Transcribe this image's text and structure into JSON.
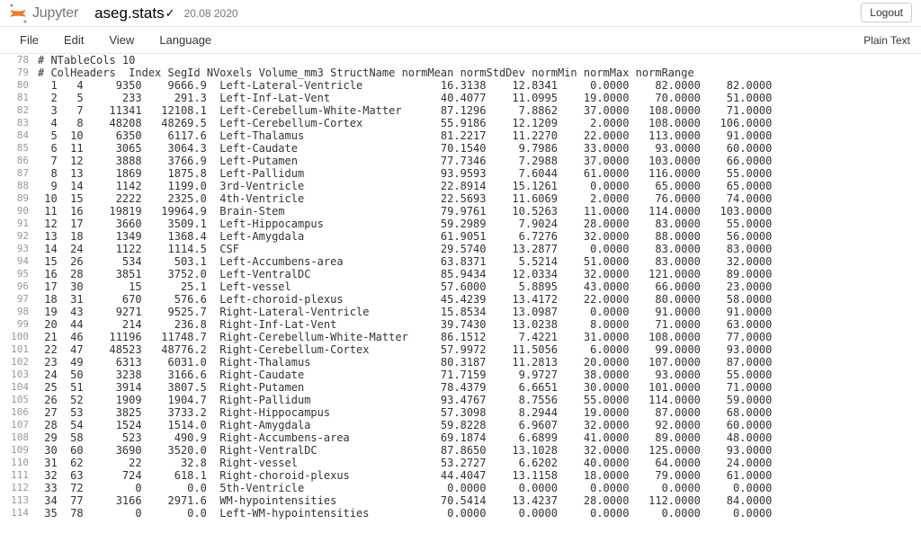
{
  "header": {
    "logo_text": "Jupyter",
    "filename": "aseg.stats",
    "check_glyph": "✓",
    "file_date": "20.08 2020",
    "logout_label": "Logout"
  },
  "menu": {
    "items": [
      "File",
      "Edit",
      "View",
      "Language"
    ],
    "mode": "Plain Text"
  },
  "stats": {
    "header_lines": [
      {
        "n": 78,
        "text": "# NTableCols 10"
      },
      {
        "n": 79,
        "text": "# ColHeaders  Index SegId NVoxels Volume_mm3 StructName normMean normStdDev normMin normMax normRange"
      }
    ],
    "cols": [
      "Index",
      "SegId",
      "NVoxels",
      "Volume_mm3",
      "StructName",
      "normMean",
      "normStdDev",
      "normMin",
      "normMax",
      "normRange"
    ],
    "rows": [
      {
        "n": 80,
        "Index": " 1",
        "SegId": "  4",
        "NVoxels": "    9350",
        "Volume_mm3": "   9666.9",
        "StructName": "Left-Lateral-Ventricle",
        "normMean": "16.3138",
        "normStdDev": "12.8341",
        "normMin": " 0.0000",
        "normMax": " 82.0000",
        "normRange": " 82.0000"
      },
      {
        "n": 81,
        "Index": " 2",
        "SegId": "  5",
        "NVoxels": "     233",
        "Volume_mm3": "    291.3",
        "StructName": "Left-Inf-Lat-Vent",
        "normMean": "40.4077",
        "normStdDev": "11.0995",
        "normMin": "19.0000",
        "normMax": " 70.0000",
        "normRange": " 51.0000"
      },
      {
        "n": 82,
        "Index": " 3",
        "SegId": "  7",
        "NVoxels": "   11341",
        "Volume_mm3": "  12108.1",
        "StructName": "Left-Cerebellum-White-Matter",
        "normMean": "87.1296",
        "normStdDev": " 7.8862",
        "normMin": "37.0000",
        "normMax": "108.0000",
        "normRange": " 71.0000"
      },
      {
        "n": 83,
        "Index": " 4",
        "SegId": "  8",
        "NVoxels": "   48208",
        "Volume_mm3": "  48269.5",
        "StructName": "Left-Cerebellum-Cortex",
        "normMean": "55.9186",
        "normStdDev": "12.1209",
        "normMin": " 2.0000",
        "normMax": "108.0000",
        "normRange": "106.0000"
      },
      {
        "n": 84,
        "Index": " 5",
        "SegId": " 10",
        "NVoxels": "    6350",
        "Volume_mm3": "   6117.6",
        "StructName": "Left-Thalamus",
        "normMean": "81.2217",
        "normStdDev": "11.2270",
        "normMin": "22.0000",
        "normMax": "113.0000",
        "normRange": " 91.0000"
      },
      {
        "n": 85,
        "Index": " 6",
        "SegId": " 11",
        "NVoxels": "    3065",
        "Volume_mm3": "   3064.3",
        "StructName": "Left-Caudate",
        "normMean": "70.1540",
        "normStdDev": " 9.7986",
        "normMin": "33.0000",
        "normMax": " 93.0000",
        "normRange": " 60.0000"
      },
      {
        "n": 86,
        "Index": " 7",
        "SegId": " 12",
        "NVoxels": "    3888",
        "Volume_mm3": "   3766.9",
        "StructName": "Left-Putamen",
        "normMean": "77.7346",
        "normStdDev": " 7.2988",
        "normMin": "37.0000",
        "normMax": "103.0000",
        "normRange": " 66.0000"
      },
      {
        "n": 87,
        "Index": " 8",
        "SegId": " 13",
        "NVoxels": "    1869",
        "Volume_mm3": "   1875.8",
        "StructName": "Left-Pallidum",
        "normMean": "93.9593",
        "normStdDev": " 7.6044",
        "normMin": "61.0000",
        "normMax": "116.0000",
        "normRange": " 55.0000"
      },
      {
        "n": 88,
        "Index": " 9",
        "SegId": " 14",
        "NVoxels": "    1142",
        "Volume_mm3": "   1199.0",
        "StructName": "3rd-Ventricle",
        "normMean": "22.8914",
        "normStdDev": "15.1261",
        "normMin": " 0.0000",
        "normMax": " 65.0000",
        "normRange": " 65.0000"
      },
      {
        "n": 89,
        "Index": "10",
        "SegId": " 15",
        "NVoxels": "    2222",
        "Volume_mm3": "   2325.0",
        "StructName": "4th-Ventricle",
        "normMean": "22.5693",
        "normStdDev": "11.6069",
        "normMin": " 2.0000",
        "normMax": " 76.0000",
        "normRange": " 74.0000"
      },
      {
        "n": 90,
        "Index": "11",
        "SegId": " 16",
        "NVoxels": "   19819",
        "Volume_mm3": "  19964.9",
        "StructName": "Brain-Stem",
        "normMean": "79.9761",
        "normStdDev": "10.5263",
        "normMin": "11.0000",
        "normMax": "114.0000",
        "normRange": "103.0000"
      },
      {
        "n": 91,
        "Index": "12",
        "SegId": " 17",
        "NVoxels": "    3660",
        "Volume_mm3": "   3509.1",
        "StructName": "Left-Hippocampus",
        "normMean": "59.2989",
        "normStdDev": " 7.9024",
        "normMin": "28.0000",
        "normMax": " 83.0000",
        "normRange": " 55.0000"
      },
      {
        "n": 92,
        "Index": "13",
        "SegId": " 18",
        "NVoxels": "    1349",
        "Volume_mm3": "   1368.4",
        "StructName": "Left-Amygdala",
        "normMean": "61.9051",
        "normStdDev": " 6.7276",
        "normMin": "32.0000",
        "normMax": " 88.0000",
        "normRange": " 56.0000"
      },
      {
        "n": 93,
        "Index": "14",
        "SegId": " 24",
        "NVoxels": "    1122",
        "Volume_mm3": "   1114.5",
        "StructName": "CSF",
        "normMean": "29.5740",
        "normStdDev": "13.2877",
        "normMin": " 0.0000",
        "normMax": " 83.0000",
        "normRange": " 83.0000"
      },
      {
        "n": 94,
        "Index": "15",
        "SegId": " 26",
        "NVoxels": "     534",
        "Volume_mm3": "    503.1",
        "StructName": "Left-Accumbens-area",
        "normMean": "63.8371",
        "normStdDev": " 5.5214",
        "normMin": "51.0000",
        "normMax": " 83.0000",
        "normRange": " 32.0000"
      },
      {
        "n": 95,
        "Index": "16",
        "SegId": " 28",
        "NVoxels": "    3851",
        "Volume_mm3": "   3752.0",
        "StructName": "Left-VentralDC",
        "normMean": "85.9434",
        "normStdDev": "12.0334",
        "normMin": "32.0000",
        "normMax": "121.0000",
        "normRange": " 89.0000"
      },
      {
        "n": 96,
        "Index": "17",
        "SegId": " 30",
        "NVoxels": "      15",
        "Volume_mm3": "     25.1",
        "StructName": "Left-vessel",
        "normMean": "57.6000",
        "normStdDev": " 5.8895",
        "normMin": "43.0000",
        "normMax": " 66.0000",
        "normRange": " 23.0000"
      },
      {
        "n": 97,
        "Index": "18",
        "SegId": " 31",
        "NVoxels": "     670",
        "Volume_mm3": "    576.6",
        "StructName": "Left-choroid-plexus",
        "normMean": "45.4239",
        "normStdDev": "13.4172",
        "normMin": "22.0000",
        "normMax": " 80.0000",
        "normRange": " 58.0000"
      },
      {
        "n": 98,
        "Index": "19",
        "SegId": " 43",
        "NVoxels": "    9271",
        "Volume_mm3": "   9525.7",
        "StructName": "Right-Lateral-Ventricle",
        "normMean": "15.8534",
        "normStdDev": "13.0987",
        "normMin": " 0.0000",
        "normMax": " 91.0000",
        "normRange": " 91.0000"
      },
      {
        "n": 99,
        "Index": "20",
        "SegId": " 44",
        "NVoxels": "     214",
        "Volume_mm3": "    236.8",
        "StructName": "Right-Inf-Lat-Vent",
        "normMean": "39.7430",
        "normStdDev": "13.0238",
        "normMin": " 8.0000",
        "normMax": " 71.0000",
        "normRange": " 63.0000"
      },
      {
        "n": 100,
        "Index": "21",
        "SegId": " 46",
        "NVoxels": "   11196",
        "Volume_mm3": "  11748.7",
        "StructName": "Right-Cerebellum-White-Matter",
        "normMean": "86.1512",
        "normStdDev": " 7.4221",
        "normMin": "31.0000",
        "normMax": "108.0000",
        "normRange": " 77.0000"
      },
      {
        "n": 101,
        "Index": "22",
        "SegId": " 47",
        "NVoxels": "   48523",
        "Volume_mm3": "  48776.2",
        "StructName": "Right-Cerebellum-Cortex",
        "normMean": "57.9972",
        "normStdDev": "11.5056",
        "normMin": " 6.0000",
        "normMax": " 99.0000",
        "normRange": " 93.0000"
      },
      {
        "n": 102,
        "Index": "23",
        "SegId": " 49",
        "NVoxels": "    6313",
        "Volume_mm3": "   6031.0",
        "StructName": "Right-Thalamus",
        "normMean": "80.3187",
        "normStdDev": "11.2813",
        "normMin": "20.0000",
        "normMax": "107.0000",
        "normRange": " 87.0000"
      },
      {
        "n": 103,
        "Index": "24",
        "SegId": " 50",
        "NVoxels": "    3238",
        "Volume_mm3": "   3166.6",
        "StructName": "Right-Caudate",
        "normMean": "71.7159",
        "normStdDev": " 9.9727",
        "normMin": "38.0000",
        "normMax": " 93.0000",
        "normRange": " 55.0000"
      },
      {
        "n": 104,
        "Index": "25",
        "SegId": " 51",
        "NVoxels": "    3914",
        "Volume_mm3": "   3807.5",
        "StructName": "Right-Putamen",
        "normMean": "78.4379",
        "normStdDev": " 6.6651",
        "normMin": "30.0000",
        "normMax": "101.0000",
        "normRange": " 71.0000"
      },
      {
        "n": 105,
        "Index": "26",
        "SegId": " 52",
        "NVoxels": "    1909",
        "Volume_mm3": "   1904.7",
        "StructName": "Right-Pallidum",
        "normMean": "93.4767",
        "normStdDev": " 8.7556",
        "normMin": "55.0000",
        "normMax": "114.0000",
        "normRange": " 59.0000"
      },
      {
        "n": 106,
        "Index": "27",
        "SegId": " 53",
        "NVoxels": "    3825",
        "Volume_mm3": "   3733.2",
        "StructName": "Right-Hippocampus",
        "normMean": "57.3098",
        "normStdDev": " 8.2944",
        "normMin": "19.0000",
        "normMax": " 87.0000",
        "normRange": " 68.0000"
      },
      {
        "n": 107,
        "Index": "28",
        "SegId": " 54",
        "NVoxels": "    1524",
        "Volume_mm3": "   1514.0",
        "StructName": "Right-Amygdala",
        "normMean": "59.8228",
        "normStdDev": " 6.9607",
        "normMin": "32.0000",
        "normMax": " 92.0000",
        "normRange": " 60.0000"
      },
      {
        "n": 108,
        "Index": "29",
        "SegId": " 58",
        "NVoxels": "     523",
        "Volume_mm3": "    490.9",
        "StructName": "Right-Accumbens-area",
        "normMean": "69.1874",
        "normStdDev": " 6.6899",
        "normMin": "41.0000",
        "normMax": " 89.0000",
        "normRange": " 48.0000"
      },
      {
        "n": 109,
        "Index": "30",
        "SegId": " 60",
        "NVoxels": "    3690",
        "Volume_mm3": "   3520.0",
        "StructName": "Right-VentralDC",
        "normMean": "87.8650",
        "normStdDev": "13.1028",
        "normMin": "32.0000",
        "normMax": "125.0000",
        "normRange": " 93.0000"
      },
      {
        "n": 110,
        "Index": "31",
        "SegId": " 62",
        "NVoxels": "      22",
        "Volume_mm3": "     32.8",
        "StructName": "Right-vessel",
        "normMean": "53.2727",
        "normStdDev": " 6.6202",
        "normMin": "40.0000",
        "normMax": " 64.0000",
        "normRange": " 24.0000"
      },
      {
        "n": 111,
        "Index": "32",
        "SegId": " 63",
        "NVoxels": "     724",
        "Volume_mm3": "    618.1",
        "StructName": "Right-choroid-plexus",
        "normMean": "44.4047",
        "normStdDev": "13.1158",
        "normMin": "18.0000",
        "normMax": " 79.0000",
        "normRange": " 61.0000"
      },
      {
        "n": 112,
        "Index": "33",
        "SegId": " 72",
        "NVoxels": "       0",
        "Volume_mm3": "      0.0",
        "StructName": "5th-Ventricle",
        "normMean": " 0.0000",
        "normStdDev": " 0.0000",
        "normMin": " 0.0000",
        "normMax": "  0.0000",
        "normRange": "  0.0000"
      },
      {
        "n": 113,
        "Index": "34",
        "SegId": " 77",
        "NVoxels": "    3166",
        "Volume_mm3": "   2971.6",
        "StructName": "WM-hypointensities",
        "normMean": "70.5414",
        "normStdDev": "13.4237",
        "normMin": "28.0000",
        "normMax": "112.0000",
        "normRange": " 84.0000"
      },
      {
        "n": 114,
        "Index": "35",
        "SegId": " 78",
        "NVoxels": "       0",
        "Volume_mm3": "      0.0",
        "StructName": "Left-WM-hypointensities",
        "normMean": " 0.0000",
        "normStdDev": " 0.0000",
        "normMin": " 0.0000",
        "normMax": "  0.0000",
        "normRange": "  0.0000"
      }
    ]
  }
}
